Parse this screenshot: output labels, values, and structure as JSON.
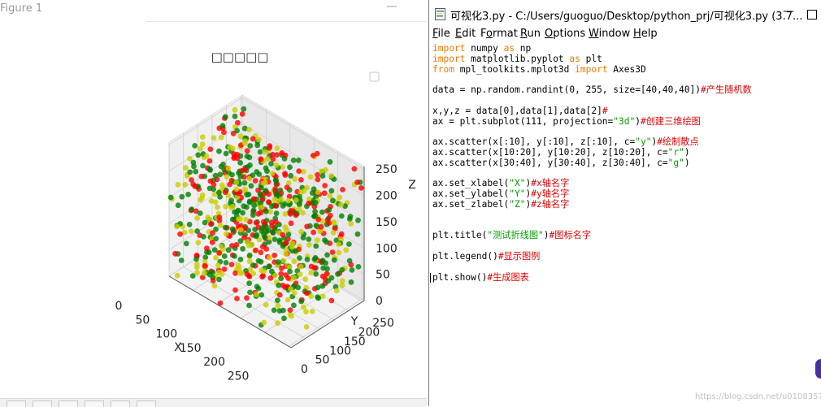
{
  "figure_window": {
    "title": "Figure 1",
    "minimize_glyph": "—"
  },
  "chart_data": {
    "type": "scatter",
    "title": "□□□□□",
    "xlabel": "X",
    "ylabel": "Y",
    "zlabel": "Z",
    "x_ticks": [
      "0",
      "50",
      "100",
      "150",
      "200",
      "250"
    ],
    "y_ticks": [
      "0",
      "50",
      "100",
      "150",
      "200",
      "250"
    ],
    "z_ticks": [
      "0",
      "50",
      "100",
      "150",
      "200",
      "250"
    ],
    "xlim": [
      0,
      255
    ],
    "ylim": [
      0,
      255
    ],
    "zlim": [
      0,
      255
    ],
    "grid": true,
    "legend": "top-right, empty",
    "series_colors": {
      "y": "#cccc00",
      "r": "#ff0000",
      "g": "#008000"
    }
  },
  "editor": {
    "title": "可视化3.py - C:/Users/guoguo/Desktop/python_prj/可视化3.py (3.7...",
    "menus": [
      {
        "pre": "",
        "u": "F",
        "post": "ile"
      },
      {
        "pre": "",
        "u": "E",
        "post": "dit"
      },
      {
        "pre": "F",
        "u": "o",
        "post": "rmat"
      },
      {
        "pre": "",
        "u": "R",
        "post": "un"
      },
      {
        "pre": "",
        "u": "O",
        "post": "ptions"
      },
      {
        "pre": "",
        "u": "W",
        "post": "indow"
      },
      {
        "pre": "",
        "u": "H",
        "post": "elp"
      }
    ],
    "code_lines": [
      [
        {
          "t": "import",
          "c": "kw"
        },
        {
          "t": " numpy ",
          "c": ""
        },
        {
          "t": "as",
          "c": "kw"
        },
        {
          "t": " np",
          "c": ""
        }
      ],
      [
        {
          "t": "import",
          "c": "kw"
        },
        {
          "t": " matplotlib.pyplot ",
          "c": ""
        },
        {
          "t": "as",
          "c": "kw"
        },
        {
          "t": " plt",
          "c": ""
        }
      ],
      [
        {
          "t": "from",
          "c": "kw"
        },
        {
          "t": " mpl_toolkits.mplot3d ",
          "c": ""
        },
        {
          "t": "import",
          "c": "kw"
        },
        {
          "t": " Axes3D",
          "c": ""
        }
      ],
      [],
      [
        {
          "t": "data = np.random.randint(0, 255, size=[40,40,40])",
          "c": ""
        },
        {
          "t": "#产生随机数",
          "c": "cmt"
        }
      ],
      [],
      [
        {
          "t": "x,y,z = data[0],data[1],data[2]",
          "c": ""
        },
        {
          "t": "#",
          "c": "cmt"
        }
      ],
      [
        {
          "t": "ax = plt.subplot(111, projection=",
          "c": ""
        },
        {
          "t": "\"3d\"",
          "c": "str"
        },
        {
          "t": ")",
          "c": ""
        },
        {
          "t": "#创建三维绘图",
          "c": "cmt"
        }
      ],
      [],
      [
        {
          "t": "ax.scatter(x[:10], y[:10], z[:10], c=",
          "c": ""
        },
        {
          "t": "\"y\"",
          "c": "str"
        },
        {
          "t": ")",
          "c": ""
        },
        {
          "t": "#绘制散点",
          "c": "cmt"
        }
      ],
      [
        {
          "t": "ax.scatter(x[10:20], y[10:20], z[10:20], c=",
          "c": ""
        },
        {
          "t": "\"r\"",
          "c": "str"
        },
        {
          "t": ")",
          "c": ""
        }
      ],
      [
        {
          "t": "ax.scatter(x[30:40], y[30:40], z[30:40], c=",
          "c": ""
        },
        {
          "t": "\"g\"",
          "c": "str"
        },
        {
          "t": ")",
          "c": ""
        }
      ],
      [],
      [
        {
          "t": "ax.set_xlabel(",
          "c": ""
        },
        {
          "t": "\"X\"",
          "c": "str"
        },
        {
          "t": ")",
          "c": ""
        },
        {
          "t": "#x轴名字",
          "c": "cmt"
        }
      ],
      [
        {
          "t": "ax.set_ylabel(",
          "c": ""
        },
        {
          "t": "\"Y\"",
          "c": "str"
        },
        {
          "t": ")",
          "c": ""
        },
        {
          "t": "#y轴名字",
          "c": "cmt"
        }
      ],
      [
        {
          "t": "ax.set_zlabel(",
          "c": ""
        },
        {
          "t": "\"Z\"",
          "c": "str"
        },
        {
          "t": ")",
          "c": ""
        },
        {
          "t": "#z轴名字",
          "c": "cmt"
        }
      ],
      [],
      [],
      [
        {
          "t": "plt.title(",
          "c": ""
        },
        {
          "t": "\"测试折线图\"",
          "c": "str"
        },
        {
          "t": ")",
          "c": ""
        },
        {
          "t": "#图标名字",
          "c": "cmt"
        }
      ],
      [],
      [
        {
          "t": "plt.legend()",
          "c": ""
        },
        {
          "t": "#显示图例",
          "c": "cmt"
        }
      ],
      [],
      [
        {
          "t": "plt.show()",
          "c": ""
        },
        {
          "t": "#生成图表",
          "c": "cmt"
        }
      ]
    ]
  },
  "watermark": "https://blog.csdn.net/u010835747"
}
